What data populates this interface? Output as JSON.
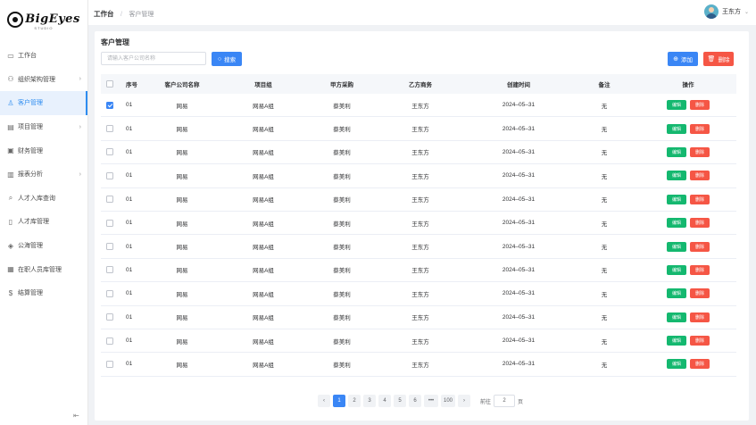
{
  "brand": {
    "logo_text": "BigEyes",
    "logo_sub": "STUDIO"
  },
  "sidebar": {
    "items": [
      {
        "label": "工作台",
        "icon": "monitor-icon",
        "arrow": false,
        "active": false
      },
      {
        "label": "组织架构管理",
        "icon": "org-icon",
        "arrow": true,
        "active": false
      },
      {
        "label": "客户管理",
        "icon": "user-icon",
        "arrow": false,
        "active": true
      },
      {
        "label": "项目管理",
        "icon": "folder-icon",
        "arrow": true,
        "active": false
      },
      {
        "label": "财务管理",
        "icon": "finance-icon",
        "arrow": false,
        "active": false
      },
      {
        "label": "报表分析",
        "icon": "chart-icon",
        "arrow": true,
        "active": false
      },
      {
        "label": "人才入库查询",
        "icon": "search-icon",
        "arrow": false,
        "active": false
      },
      {
        "label": "人才库管理",
        "icon": "document-icon",
        "arrow": false,
        "active": false
      },
      {
        "label": "公海管理",
        "icon": "layers-icon",
        "arrow": false,
        "active": false
      },
      {
        "label": "在职人员库管理",
        "icon": "staff-icon",
        "arrow": false,
        "active": false
      },
      {
        "label": "结算管理",
        "icon": "dollar-icon",
        "arrow": false,
        "active": false
      }
    ]
  },
  "header": {
    "breadcrumb_home": "工作台",
    "breadcrumb_sep": "/",
    "breadcrumb_current": "客户管理",
    "user_name": "王东方"
  },
  "main": {
    "title": "客户管理",
    "search_placeholder": "请输入客户公司名称",
    "search_button": "搜索",
    "add_button": "添加",
    "delete_button": "删除",
    "columns": [
      "序号",
      "客户公司名称",
      "项目组",
      "甲方采购",
      "乙方商务",
      "创建时间",
      "备注",
      "操作"
    ],
    "rows": [
      {
        "checked": true,
        "idx": "01",
        "name": "网易",
        "group": "网易A组",
        "buyer": "蔡美利",
        "biz": "王东方",
        "time": "2024–05–31",
        "note": "无"
      },
      {
        "checked": false,
        "idx": "01",
        "name": "网易",
        "group": "网易A组",
        "buyer": "蔡美利",
        "biz": "王东方",
        "time": "2024–05–31",
        "note": "无"
      },
      {
        "checked": false,
        "idx": "01",
        "name": "网易",
        "group": "网易A组",
        "buyer": "蔡美利",
        "biz": "王东方",
        "time": "2024–05–31",
        "note": "无"
      },
      {
        "checked": false,
        "idx": "01",
        "name": "网易",
        "group": "网易A组",
        "buyer": "蔡美利",
        "biz": "王东方",
        "time": "2024–05–31",
        "note": "无"
      },
      {
        "checked": false,
        "idx": "01",
        "name": "网易",
        "group": "网易A组",
        "buyer": "蔡美利",
        "biz": "王东方",
        "time": "2024–05–31",
        "note": "无"
      },
      {
        "checked": false,
        "idx": "01",
        "name": "网易",
        "group": "网易A组",
        "buyer": "蔡美利",
        "biz": "王东方",
        "time": "2024–05–31",
        "note": "无"
      },
      {
        "checked": false,
        "idx": "01",
        "name": "网易",
        "group": "网易A组",
        "buyer": "蔡美利",
        "biz": "王东方",
        "time": "2024–05–31",
        "note": "无"
      },
      {
        "checked": false,
        "idx": "01",
        "name": "网易",
        "group": "网易A组",
        "buyer": "蔡美利",
        "biz": "王东方",
        "time": "2024–05–31",
        "note": "无"
      },
      {
        "checked": false,
        "idx": "01",
        "name": "网易",
        "group": "网易A组",
        "buyer": "蔡美利",
        "biz": "王东方",
        "time": "2024–05–31",
        "note": "无"
      },
      {
        "checked": false,
        "idx": "01",
        "name": "网易",
        "group": "网易A组",
        "buyer": "蔡美利",
        "biz": "王东方",
        "time": "2024–05–31",
        "note": "无"
      },
      {
        "checked": false,
        "idx": "01",
        "name": "网易",
        "group": "网易A组",
        "buyer": "蔡美利",
        "biz": "王东方",
        "time": "2024–05–31",
        "note": "无"
      },
      {
        "checked": false,
        "idx": "01",
        "name": "网易",
        "group": "网易A组",
        "buyer": "蔡美利",
        "biz": "王东方",
        "time": "2024–05–31",
        "note": "无"
      }
    ],
    "row_edit_label": "编辑",
    "row_delete_label": "删除"
  },
  "pagination": {
    "prev": "‹",
    "pages": [
      "1",
      "2",
      "3",
      "4",
      "5",
      "6",
      "•••",
      "100"
    ],
    "current": "1",
    "next": "›",
    "goto_label": "前往",
    "goto_value": "2",
    "unit": "页"
  },
  "colors": {
    "primary": "#3a86f5",
    "danger": "#f55645",
    "success": "#14b86f"
  }
}
